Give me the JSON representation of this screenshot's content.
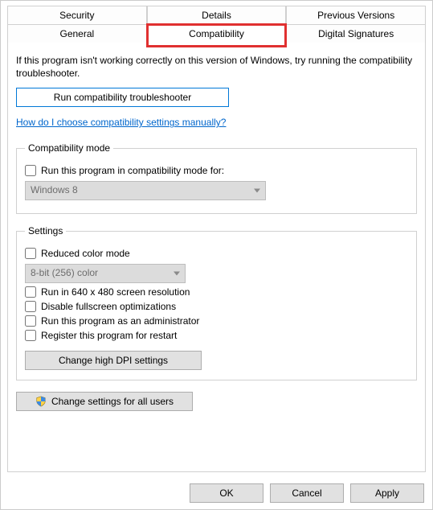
{
  "tabs": {
    "row1": [
      "Security",
      "Details",
      "Previous Versions"
    ],
    "row2": [
      "General",
      "Compatibility",
      "Digital Signatures"
    ],
    "active": "Compatibility"
  },
  "intro": "If this program isn't working correctly on this version of Windows, try running the compatibility troubleshooter.",
  "run_troubleshooter": "Run compatibility troubleshooter",
  "manual_link": "How do I choose compatibility settings manually?",
  "compat_group": {
    "legend": "Compatibility mode",
    "checkbox": "Run this program in compatibility mode for:",
    "select": "Windows 8"
  },
  "settings_group": {
    "legend": "Settings",
    "reduced_color": "Reduced color mode",
    "color_select": "8-bit (256) color",
    "run_640": "Run in 640 x 480 screen resolution",
    "disable_fullscreen": "Disable fullscreen optimizations",
    "run_admin": "Run this program as an administrator",
    "register_restart": "Register this program for restart",
    "dpi_button": "Change high DPI settings"
  },
  "all_users_button": "Change settings for all users",
  "footer": {
    "ok": "OK",
    "cancel": "Cancel",
    "apply": "Apply"
  }
}
